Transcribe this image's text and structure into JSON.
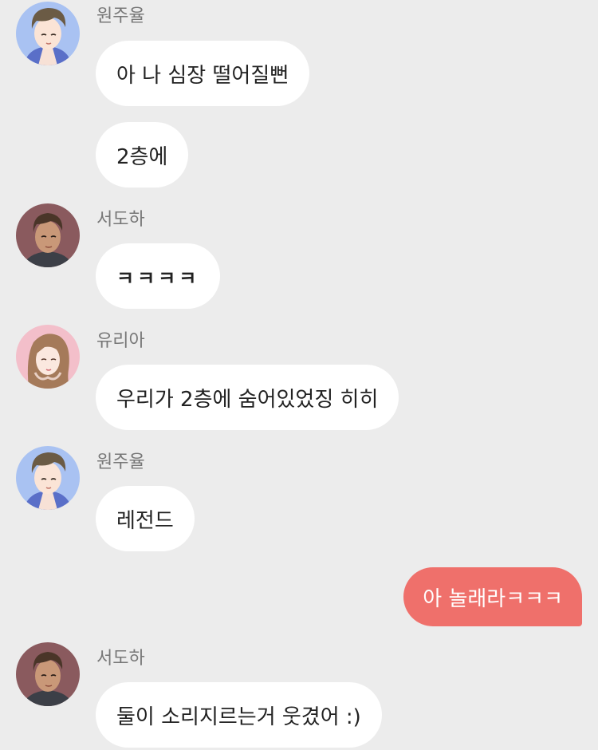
{
  "messages": [
    {
      "sender": "원주율",
      "avatar": "boy-blue-avatar",
      "bubbles": [
        "아 나 심장 떨어질뻔",
        "2층에"
      ]
    },
    {
      "sender": "서도하",
      "avatar": "boy-dark-avatar",
      "bubbles": [
        "ㅋㅋㅋㅋ"
      ]
    },
    {
      "sender": "유리아",
      "avatar": "girl-pink-avatar",
      "bubbles": [
        "우리가 2층에 숨어있었징 히히"
      ]
    },
    {
      "sender": "원주율",
      "avatar": "boy-blue-avatar",
      "bubbles": [
        "레전드"
      ]
    },
    {
      "sender": "me",
      "bubbles": [
        "아 놀래라ㅋㅋㅋ"
      ]
    },
    {
      "sender": "서도하",
      "avatar": "boy-dark-avatar",
      "bubbles": [
        "둘이 소리지르는거 웃겼어 :)"
      ]
    }
  ],
  "colors": {
    "background": "#ececec",
    "incoming_bubble": "#ffffff",
    "outgoing_bubble": "#ef706b"
  }
}
